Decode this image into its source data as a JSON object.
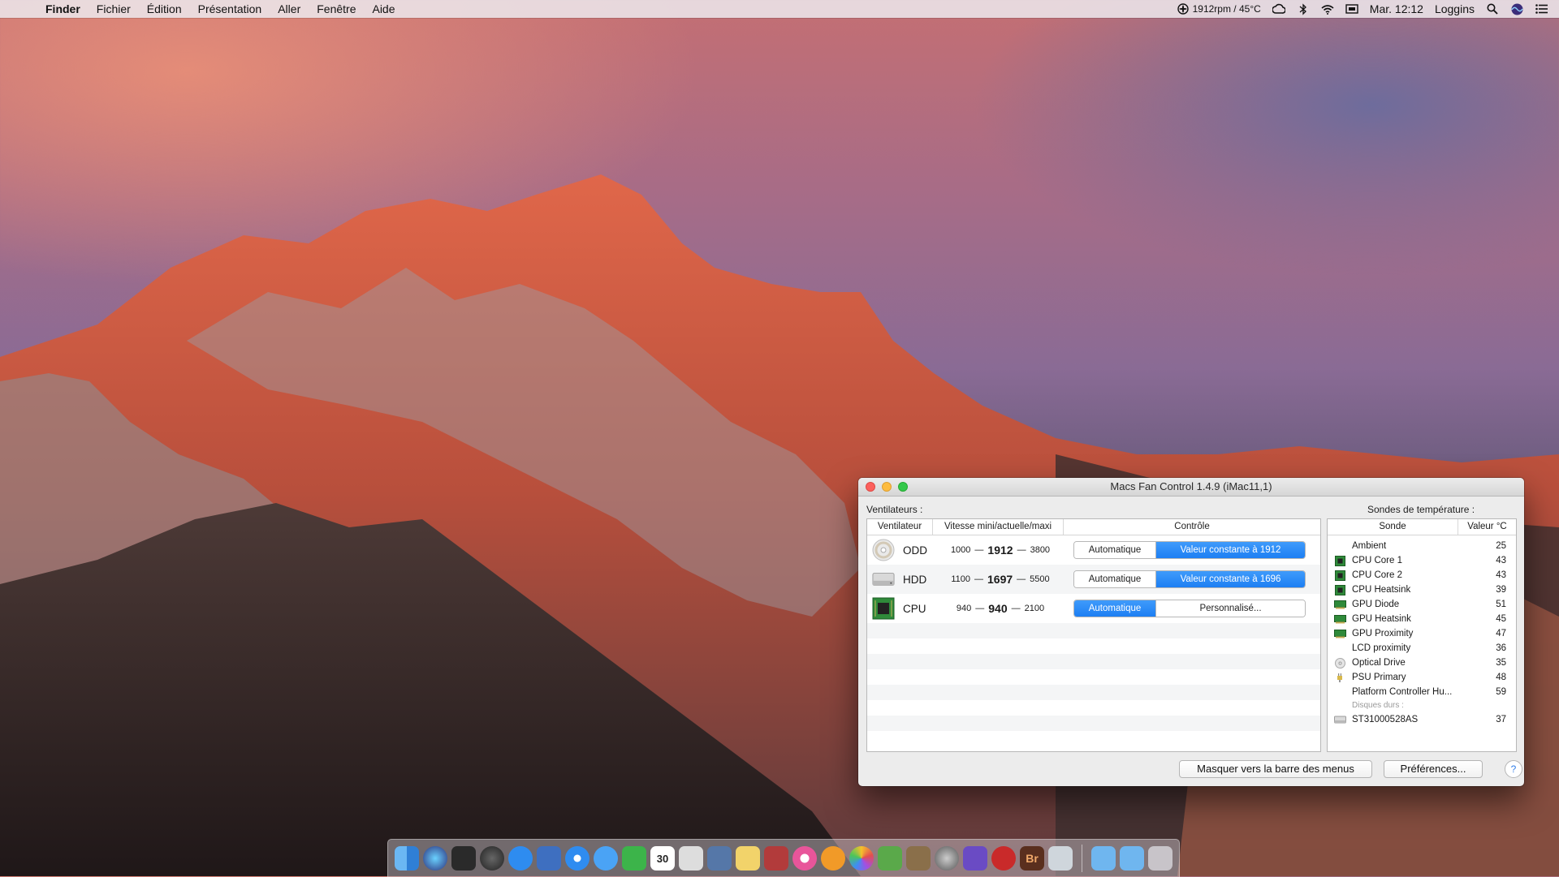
{
  "menubar": {
    "app_name": "Finder",
    "items": [
      "Fichier",
      "Édition",
      "Présentation",
      "Aller",
      "Fenêtre",
      "Aide"
    ],
    "status": {
      "fan_readout": "1912rpm / 45°C",
      "clock": "Mar. 12:12",
      "user": "Loggins"
    }
  },
  "window": {
    "title": "Macs Fan Control 1.4.9 (iMac11,1)",
    "fans_label": "Ventilateurs :",
    "temps_label": "Sondes de température :",
    "fans_columns": [
      "Ventilateur",
      "Vitesse mini/actuelle/maxi",
      "Contrôle"
    ],
    "fans": [
      {
        "name": "ODD",
        "icon": "optical-drive-icon",
        "min": "1000",
        "current": "1912",
        "max": "3800",
        "auto_label": "Automatique",
        "custom_label": "Valeur constante à 1912",
        "mode": "custom"
      },
      {
        "name": "HDD",
        "icon": "hard-drive-icon",
        "min": "1100",
        "current": "1697",
        "max": "5500",
        "auto_label": "Automatique",
        "custom_label": "Valeur constante à 1696",
        "mode": "custom"
      },
      {
        "name": "CPU",
        "icon": "cpu-chip-icon",
        "min": "940",
        "current": "940",
        "max": "2100",
        "auto_label": "Automatique",
        "custom_label": "Personnalisé...",
        "mode": "auto"
      }
    ],
    "temps_columns": [
      "Sonde",
      "Valeur °C"
    ],
    "sensors": [
      {
        "name": "Ambient",
        "value": "25",
        "icon": "none"
      },
      {
        "name": "CPU Core 1",
        "value": "43",
        "icon": "cpu-chip-icon"
      },
      {
        "name": "CPU Core 2",
        "value": "43",
        "icon": "cpu-chip-icon"
      },
      {
        "name": "CPU Heatsink",
        "value": "39",
        "icon": "cpu-chip-icon"
      },
      {
        "name": "GPU Diode",
        "value": "51",
        "icon": "gpu-card-icon"
      },
      {
        "name": "GPU Heatsink",
        "value": "45",
        "icon": "gpu-card-icon"
      },
      {
        "name": "GPU Proximity",
        "value": "47",
        "icon": "gpu-card-icon"
      },
      {
        "name": "LCD proximity",
        "value": "36",
        "icon": "none"
      },
      {
        "name": "Optical Drive",
        "value": "35",
        "icon": "optical-drive-icon"
      },
      {
        "name": "PSU Primary",
        "value": "48",
        "icon": "power-plug-icon"
      },
      {
        "name": "Platform Controller Hu...",
        "value": "59",
        "icon": "none"
      }
    ],
    "disks_group": "Disques durs :",
    "disks": [
      {
        "name": "ST31000528AS",
        "value": "37",
        "icon": "hard-drive-icon"
      }
    ],
    "hide_button": "Masquer vers la barre des menus",
    "prefs_button": "Préférences...",
    "help_button": "?"
  },
  "dock": {
    "calendar_day": "30",
    "bridge_label": "Br",
    "apps": [
      "finder-icon",
      "siri-icon",
      "mission-control-icon",
      "launchpad-icon",
      "app-store-icon",
      "system-utility-icon",
      "safari-icon",
      "messages-icon",
      "facetime-icon",
      "calendar-icon",
      "itunes-ipod-icon",
      "preview-icon",
      "stickies-icon",
      "photo-booth-icon",
      "itunes-icon",
      "ibooks-icon",
      "photos-icon",
      "keychain-icon",
      "utility-brush-icon",
      "system-preferences-icon",
      "imovie-icon",
      "macs-fan-control-icon",
      "adobe-bridge-icon",
      "image-capture-icon",
      "applications-folder-icon",
      "documents-folder-icon",
      "trash-icon"
    ]
  },
  "colors": {
    "accent": "#1d7ff3",
    "close": "#fc605c",
    "minimize": "#fdbc40",
    "maximize": "#34c84a"
  }
}
